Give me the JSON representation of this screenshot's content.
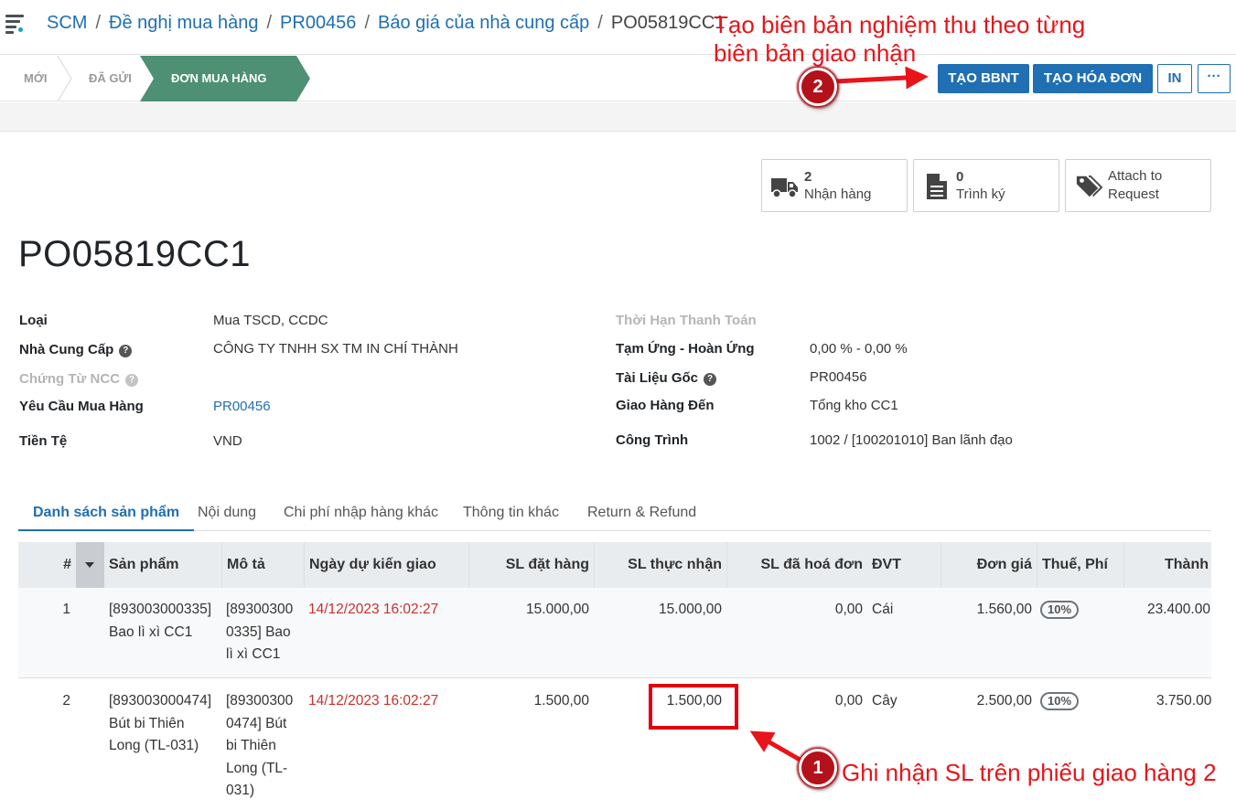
{
  "breadcrumb": [
    "SCM",
    "Đề nghị mua hàng",
    "PR00456",
    "Báo giá của nhà cung cấp"
  ],
  "breadcrumb_current": "PO05819CC1",
  "statusbar": {
    "stages": [
      "MỚI",
      "ĐÃ GỬI",
      "ĐƠN MUA HÀNG"
    ],
    "active_stage": "ĐƠN MUA HÀNG",
    "buttons": {
      "create_bbnt": "TẠO BBNT",
      "create_invoice": "TẠO HÓA ĐƠN",
      "print": "IN",
      "more": "···"
    }
  },
  "smart_buttons": {
    "receipts": {
      "count": "2",
      "label": "Nhận hàng"
    },
    "approvals": {
      "count": "0",
      "label": "Trình ký"
    },
    "attach": {
      "line1": "Attach to",
      "line2": "Request"
    }
  },
  "record_title": "PO05819CC1",
  "fields_left": {
    "type": {
      "label": "Loại",
      "value": "Mua TSCD, CCDC"
    },
    "vendor": {
      "label": "Nhà Cung Cấp",
      "value": "CÔNG TY TNHH SX TM IN CHÍ THÀNH"
    },
    "vendor_doc": {
      "label": "Chứng Từ NCC",
      "value": ""
    },
    "purchase_request": {
      "label": "Yêu Cầu Mua Hàng",
      "value": "PR00456"
    },
    "currency": {
      "label": "Tiền Tệ",
      "value": "VND"
    }
  },
  "fields_right": {
    "payment_term": {
      "label": "Thời Hạn Thanh Toán",
      "value": ""
    },
    "advance": {
      "label": "Tạm Ứng - Hoàn Ứng",
      "value": "0,00 % - 0,00 %"
    },
    "source_doc": {
      "label": "Tài Liệu Gốc",
      "value": "PR00456"
    },
    "deliver_to": {
      "label": "Giao Hàng Đến",
      "value": "Tổng kho CC1"
    },
    "project": {
      "label": "Công Trình",
      "value": "1002 / [100201010] Ban lãnh đạo"
    }
  },
  "tabs": [
    "Danh sách sản phẩm",
    "Nội dung",
    "Chi phí nhập hàng khác",
    "Thông tin khác",
    "Return & Refund"
  ],
  "table": {
    "headers": [
      "#",
      "Sản phẩm",
      "Mô tả",
      "Ngày dự kiến giao",
      "SL đặt hàng",
      "SL thực nhận",
      "SL đã hoá đơn",
      "ĐVT",
      "Đơn giá",
      "Thuế, Phí",
      "Thành tiền"
    ],
    "rows": [
      {
        "no": "1",
        "product_lines": [
          "[893003000335]",
          "Bao lì xì CC1"
        ],
        "desc_lines": [
          "[89300300",
          "0335] Bao",
          "lì xì CC1"
        ],
        "date": "14/12/2023 16:02:27",
        "qty_ordered": "15.000,00",
        "qty_received": "15.000,00",
        "qty_invoiced": "0,00",
        "uom": "Cái",
        "price": "1.560,00",
        "tax": "10%",
        "subtotal": "23.400.00"
      },
      {
        "no": "2",
        "product_lines": [
          "[893003000474]",
          "Bút bi Thiên",
          "Long (TL-031)"
        ],
        "desc_lines": [
          "[89300300",
          "0474] Bút",
          "bi Thiên",
          "Long (TL-",
          "031)"
        ],
        "date": "14/12/2023 16:02:27",
        "qty_ordered": "1.500,00",
        "qty_received": "1.500,00",
        "qty_invoiced": "0,00",
        "uom": "Cây",
        "price": "2.500,00",
        "tax": "10%",
        "subtotal": "3.750.00"
      }
    ]
  },
  "annotations": {
    "note_top_line1": "Tạo biên bản nghiệm thu theo từng",
    "note_top_line2": "biên bản giao nhận",
    "badge_top": "2",
    "note_bottom": "Ghi nhận SL trên phiếu giao hàng 2",
    "badge_bottom": "1",
    "color": "#e8141a"
  }
}
